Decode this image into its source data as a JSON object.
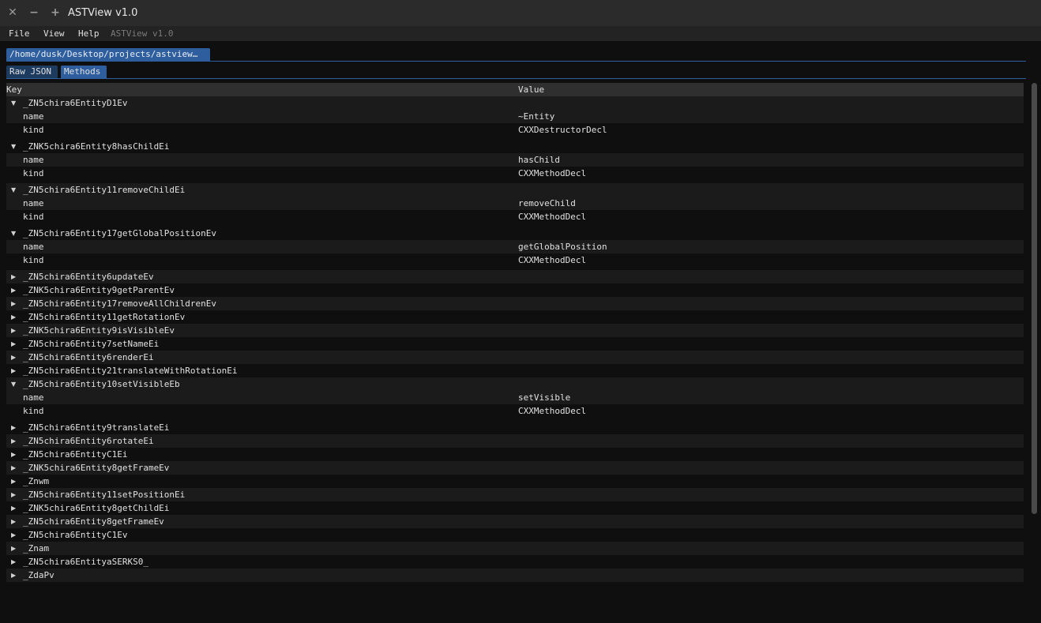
{
  "window": {
    "title": "ASTView v1.0",
    "close_glyph": "✕",
    "min_glyph": "−",
    "max_glyph": "+"
  },
  "menubar": {
    "file": "File",
    "view": "View",
    "help": "Help",
    "caption": "ASTView v1.0"
  },
  "file_tab": {
    "label": "/home/dusk/Desktop/projects/astview…"
  },
  "tabs": {
    "raw_json": "Raw JSON",
    "methods": "Methods"
  },
  "table": {
    "headers": {
      "key": "Key",
      "value": "Value"
    },
    "rows": [
      {
        "kind": "node",
        "open": true,
        "key": "_ZN5chira6EntityD1Ev"
      },
      {
        "kind": "leaf",
        "key": "name",
        "value": "~Entity"
      },
      {
        "kind": "leaf",
        "key": "kind",
        "value": "CXXDestructorDecl"
      },
      {
        "kind": "node",
        "open": true,
        "key": "_ZNK5chira6Entity8hasChildEi"
      },
      {
        "kind": "leaf",
        "key": "name",
        "value": "hasChild"
      },
      {
        "kind": "leaf",
        "key": "kind",
        "value": "CXXMethodDecl"
      },
      {
        "kind": "node",
        "open": true,
        "key": "_ZN5chira6Entity11removeChildEi"
      },
      {
        "kind": "leaf",
        "key": "name",
        "value": "removeChild"
      },
      {
        "kind": "leaf",
        "key": "kind",
        "value": "CXXMethodDecl"
      },
      {
        "kind": "node",
        "open": true,
        "key": "_ZN5chira6Entity17getGlobalPositionEv"
      },
      {
        "kind": "leaf",
        "key": "name",
        "value": "getGlobalPosition"
      },
      {
        "kind": "leaf",
        "key": "kind",
        "value": "CXXMethodDecl"
      },
      {
        "kind": "node",
        "open": false,
        "key": "_ZN5chira6Entity6updateEv"
      },
      {
        "kind": "node",
        "open": false,
        "key": "_ZNK5chira6Entity9getParentEv"
      },
      {
        "kind": "node",
        "open": false,
        "key": "_ZN5chira6Entity17removeAllChildrenEv"
      },
      {
        "kind": "node",
        "open": false,
        "key": "_ZN5chira6Entity11getRotationEv"
      },
      {
        "kind": "node",
        "open": false,
        "key": "_ZNK5chira6Entity9isVisibleEv"
      },
      {
        "kind": "node",
        "open": false,
        "key": "_ZN5chira6Entity7setNameEi"
      },
      {
        "kind": "node",
        "open": false,
        "key": "_ZN5chira6Entity6renderEi"
      },
      {
        "kind": "node",
        "open": false,
        "key": "_ZN5chira6Entity21translateWithRotationEi"
      },
      {
        "kind": "node",
        "open": true,
        "key": "_ZN5chira6Entity10setVisibleEb"
      },
      {
        "kind": "leaf",
        "key": "name",
        "value": "setVisible"
      },
      {
        "kind": "leaf",
        "key": "kind",
        "value": "CXXMethodDecl"
      },
      {
        "kind": "node",
        "open": false,
        "key": "_ZN5chira6Entity9translateEi"
      },
      {
        "kind": "node",
        "open": false,
        "key": "_ZN5chira6Entity6rotateEi"
      },
      {
        "kind": "node",
        "open": false,
        "key": "_ZN5chira6EntityC1Ei"
      },
      {
        "kind": "node",
        "open": false,
        "key": "_ZNK5chira6Entity8getFrameEv"
      },
      {
        "kind": "node",
        "open": false,
        "key": "_Znwm"
      },
      {
        "kind": "node",
        "open": false,
        "key": "_ZN5chira6Entity11setPositionEi"
      },
      {
        "kind": "node",
        "open": false,
        "key": "_ZNK5chira6Entity8getChildEi"
      },
      {
        "kind": "node",
        "open": false,
        "key": "_ZN5chira6Entity8getFrameEv"
      },
      {
        "kind": "node",
        "open": false,
        "key": "_ZN5chira6EntityC1Ev"
      },
      {
        "kind": "node",
        "open": false,
        "key": "_Znam"
      },
      {
        "kind": "node",
        "open": false,
        "key": "_ZN5chira6EntityaSERKS0_"
      },
      {
        "kind": "node",
        "open": false,
        "key": "_ZdaPv"
      }
    ]
  },
  "icons": {
    "expanded": "caret-down-icon",
    "collapsed": "caret-right-icon"
  },
  "colors": {
    "accent": "#2e5e9e",
    "background": "#0f0f0f",
    "row_alt": "#1b1b1b",
    "header": "#2f2f2f"
  }
}
